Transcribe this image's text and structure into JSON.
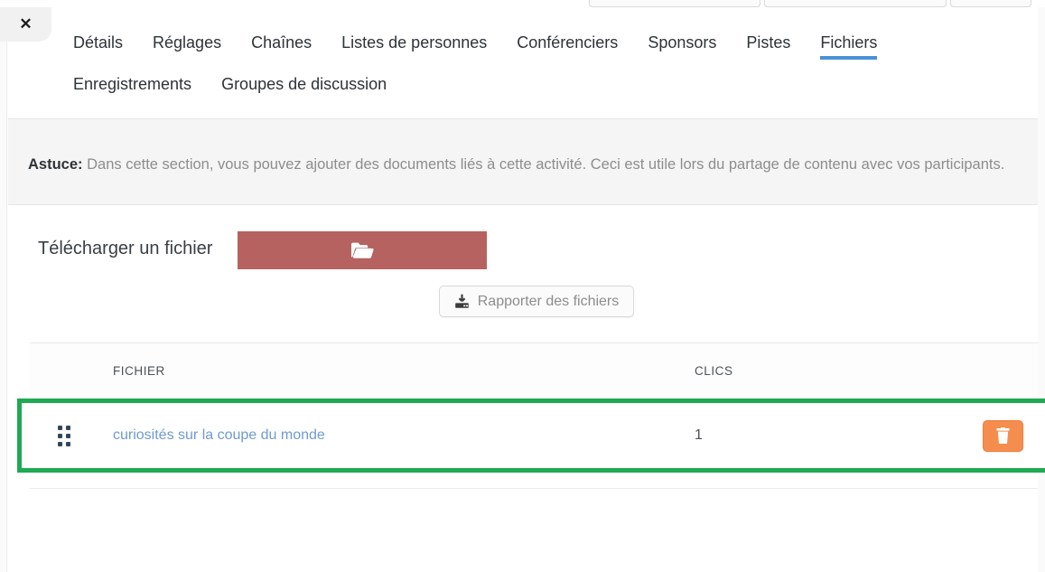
{
  "window": {
    "close_label": "✕"
  },
  "tabs": {
    "row1": [
      {
        "label": "Détails",
        "active": false
      },
      {
        "label": "Réglages",
        "active": false
      },
      {
        "label": "Chaînes",
        "active": false
      },
      {
        "label": "Listes de personnes",
        "active": false
      },
      {
        "label": "Conférenciers",
        "active": false
      },
      {
        "label": "Sponsors",
        "active": false
      },
      {
        "label": "Pistes",
        "active": false
      },
      {
        "label": "Fichiers",
        "active": true
      }
    ],
    "row2": [
      {
        "label": "Enregistrements",
        "active": false
      },
      {
        "label": "Groupes de discussion",
        "active": false
      }
    ],
    "active_tab": "Fichiers",
    "active_underline_color": "#4a90d9"
  },
  "tip": {
    "prefix": "Astuce:",
    "body": " Dans cette section, vous pouvez ajouter des documents liés à cette activité. Ceci est utile lors du partage de contenu avec vos participants."
  },
  "upload": {
    "label": "Télécharger un fichier",
    "button_icon": "folder-open-icon",
    "button_color": "#b56260"
  },
  "report": {
    "label": "Rapporter des fichiers",
    "icon": "download-icon"
  },
  "table": {
    "headers": {
      "handle": "",
      "file": "FICHIER",
      "clicks": "CLICS",
      "action": ""
    },
    "rows": [
      {
        "handle_icon": "drag-handle-icon",
        "file": "curiosités sur la coupe du monde",
        "clicks": "1",
        "delete_icon": "trash-icon",
        "highlighted": true
      }
    ],
    "highlight_color": "#1eaa52",
    "delete_button_color": "#f58d4e",
    "link_color": "#6f9ad3"
  }
}
